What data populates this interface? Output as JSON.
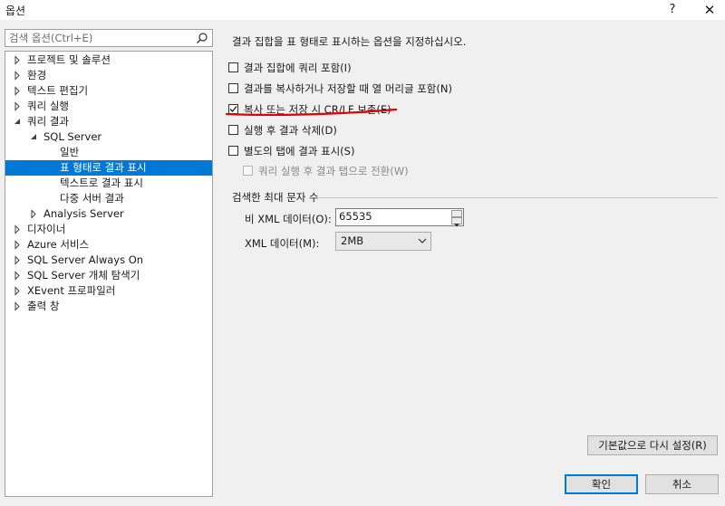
{
  "window": {
    "title": "옵션",
    "help": "?",
    "close": "✕"
  },
  "search": {
    "placeholder": "검색 옵션(Ctrl+E)"
  },
  "tree": {
    "items": [
      {
        "label": "프로젝트 및 솔루션",
        "level": 0,
        "expanded": false
      },
      {
        "label": "환경",
        "level": 0,
        "expanded": false
      },
      {
        "label": "텍스트 편집기",
        "level": 0,
        "expanded": false
      },
      {
        "label": "쿼리 실행",
        "level": 0,
        "expanded": false
      },
      {
        "label": "쿼리 결과",
        "level": 0,
        "expanded": true
      },
      {
        "label": "SQL Server",
        "level": 1,
        "expanded": true
      },
      {
        "label": "일반",
        "level": 2
      },
      {
        "label": "표 형태로 결과 표시",
        "level": 2,
        "selected": true
      },
      {
        "label": "텍스트로 결과 표시",
        "level": 2
      },
      {
        "label": "다중 서버 결과",
        "level": 2
      },
      {
        "label": "Analysis Server",
        "level": 1,
        "expanded": false
      },
      {
        "label": "디자이너",
        "level": 0,
        "expanded": false
      },
      {
        "label": "Azure 서비스",
        "level": 0,
        "expanded": false
      },
      {
        "label": "SQL Server Always On",
        "level": 0,
        "expanded": false
      },
      {
        "label": "SQL Server 개체 탐색기",
        "level": 0,
        "expanded": false
      },
      {
        "label": "XEvent 프로파일러",
        "level": 0,
        "expanded": false
      },
      {
        "label": "출력 창",
        "level": 0,
        "expanded": false
      }
    ]
  },
  "content": {
    "description": "결과 집합을 표 형태로 표시하는 옵션을 지정하십시오.",
    "options": [
      {
        "label": "결과 집합에 쿼리 포함(I)",
        "checked": false,
        "enabled": true
      },
      {
        "label": "결과를 복사하거나 저장할 때 열 머리글 포함(N)",
        "checked": false,
        "enabled": true
      },
      {
        "label": "복사 또는 저장 시 CR/LF 보존(E)",
        "checked": true,
        "enabled": true
      },
      {
        "label": "실행 후 결과 삭제(D)",
        "checked": false,
        "enabled": true
      },
      {
        "label": "별도의 탭에 결과 표시(S)",
        "checked": false,
        "enabled": true
      },
      {
        "label": "쿼리 실행 후 결과 탭으로 전환(W)",
        "checked": false,
        "enabled": false
      }
    ],
    "max_chars": {
      "title": "검색한 최대 문자 수",
      "nonxml_label": "비 XML 데이터(O):",
      "nonxml_value": "65535",
      "xml_label": "XML 데이터(M):",
      "xml_value": "2MB"
    },
    "highlight_color": "#e00000"
  },
  "buttons": {
    "reset": "기본값으로 다시 설정(R)",
    "ok": "확인",
    "cancel": "취소"
  },
  "colors": {
    "selection": "#0078d7",
    "background": "#f0f0f0"
  }
}
